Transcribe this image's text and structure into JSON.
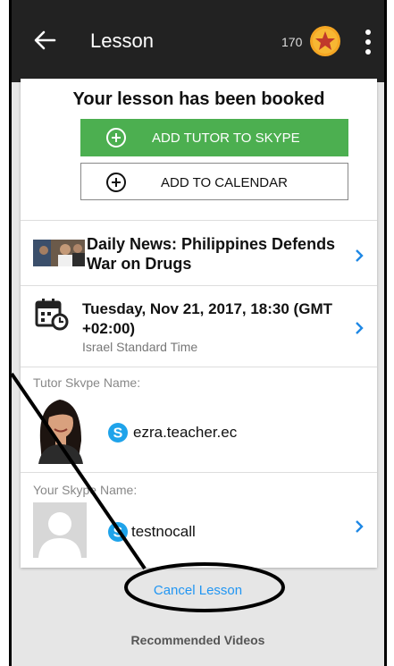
{
  "appbar": {
    "title": "Lesson",
    "coins": "170"
  },
  "booking": {
    "heading": "Your lesson has been booked",
    "add_skype_label": "ADD TUTOR TO SKYPE",
    "add_calendar_label": "ADD TO CALENDAR"
  },
  "lesson": {
    "title": "Daily News: Philippines Defends War on Drugs",
    "datetime": "Tuesday, Nov 21, 2017, 18:30 (GMT +02:00)",
    "timezone": "Israel Standard Time"
  },
  "tutor": {
    "label": "Tutor Skype Name:",
    "skype": "ezra.teacher.ec"
  },
  "user": {
    "label": "Your Skype Name:",
    "skype": "testnocall"
  },
  "actions": {
    "cancel_label": "Cancel Lesson"
  },
  "sections": {
    "recommended_label": "Recommended Videos"
  },
  "icons": {
    "back": "arrow-left-icon",
    "coin": "star-coin-icon",
    "menu": "more-vert-icon",
    "add": "plus-circle-icon",
    "calendar": "calendar-clock-icon",
    "skype": "skype-icon",
    "chevron": "chevron-right-icon"
  },
  "colors": {
    "appbar": "#222222",
    "primary_button": "#4caf50",
    "link": "#2196f3",
    "coin": "#f5a623",
    "skype": "#1fa3ea"
  }
}
